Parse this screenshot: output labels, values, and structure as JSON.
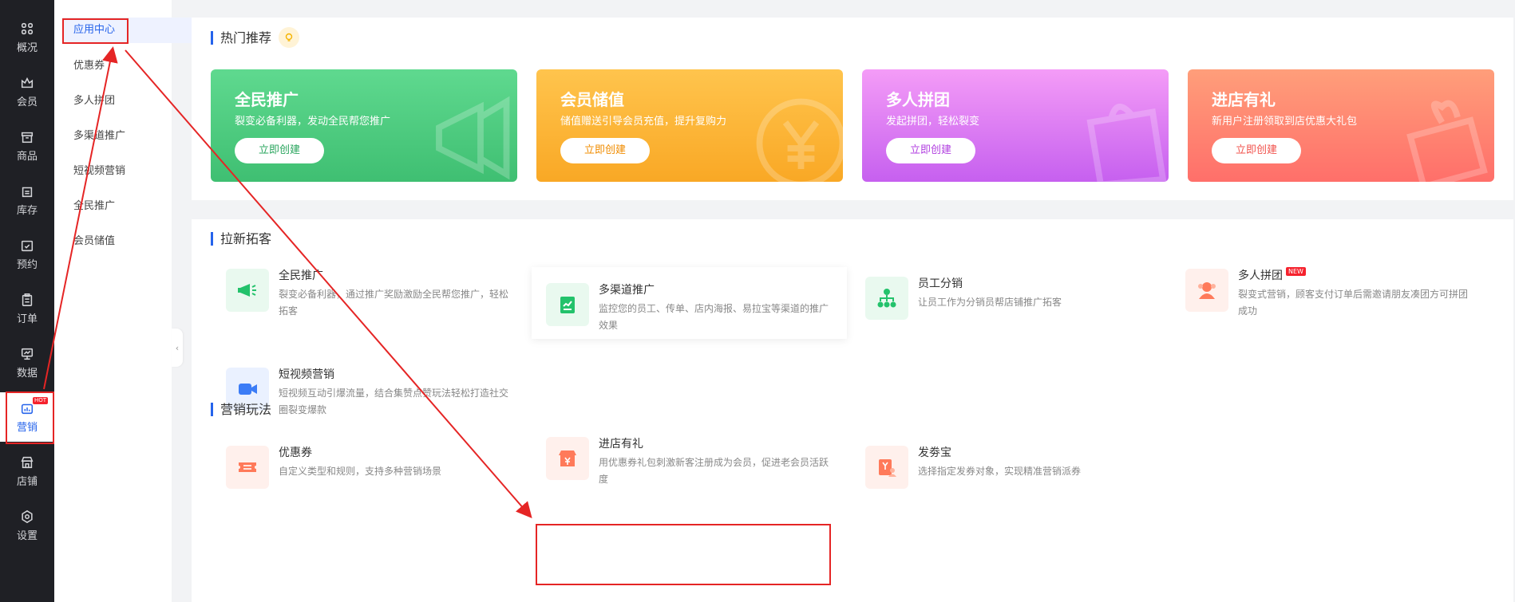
{
  "left_nav": [
    {
      "label": "概况",
      "icon": "grid-icon"
    },
    {
      "label": "会员",
      "icon": "crown-icon"
    },
    {
      "label": "商品",
      "icon": "store-box-icon"
    },
    {
      "label": "库存",
      "icon": "warehouse-icon"
    },
    {
      "label": "预约",
      "icon": "calendar-check-icon"
    },
    {
      "label": "订单",
      "icon": "clipboard-icon"
    },
    {
      "label": "数据",
      "icon": "monitor-chart-icon"
    },
    {
      "label": "营销",
      "icon": "chart-bag-icon",
      "badge": "HOT",
      "active": true
    },
    {
      "label": "店铺",
      "icon": "shop-icon"
    },
    {
      "label": "设置",
      "icon": "gear-icon"
    }
  ],
  "sub_nav": [
    {
      "label": "应用中心",
      "active": true
    },
    {
      "label": "优惠券"
    },
    {
      "label": "多人拼团"
    },
    {
      "label": "多渠道推广"
    },
    {
      "label": "短视频营销"
    },
    {
      "label": "全民推广"
    },
    {
      "label": "会员储值"
    }
  ],
  "hot_section": {
    "title": "热门推荐",
    "cards": [
      {
        "title": "全民推广",
        "desc": "裂变必备利器，发动全民帮您推广",
        "button": "立即创建",
        "color_from": "#5fd98f",
        "color_to": "#3fbf72",
        "btn_text_color": "#2aa55e",
        "icon": "megaphone-icon"
      },
      {
        "title": "会员储值",
        "desc": "储值赠送引导会员充值，提升复购力",
        "button": "立即创建",
        "color_from": "#ffc44d",
        "color_to": "#f9a825",
        "btn_text_color": "#f08c00",
        "icon": "yen-coin-icon"
      },
      {
        "title": "多人拼团",
        "desc": "发起拼团，轻松裂变",
        "button": "立即创建",
        "color_from": "#f49cf7",
        "color_to": "#c660ef",
        "btn_text_color": "#b13fe0",
        "icon": "shopping-bag-icon"
      },
      {
        "title": "进店有礼",
        "desc": "新用户注册领取到店优惠大礼包",
        "button": "立即创建",
        "color_from": "#ff9e7a",
        "color_to": "#ff6f6a",
        "btn_text_color": "#f1534d",
        "icon": "gift-icon"
      }
    ]
  },
  "acquire_section": {
    "title": "拉新拓客",
    "items": [
      {
        "name": "全民推广",
        "desc": "裂变必备利器，通过推广奖励激励全民帮您推广，轻松拓客",
        "icon": "megaphone-icon",
        "icon_bg": "#e9f9ef",
        "icon_color": "#23c26b"
      },
      {
        "name": "多渠道推广",
        "desc": "监控您的员工、传单、店内海报、易拉宝等渠道的推广效果",
        "icon": "chart-doc-icon",
        "icon_bg": "#e9f9ef",
        "icon_color": "#23c26b"
      },
      {
        "name": "员工分销",
        "desc": "让员工作为分销员帮店铺推广拓客",
        "icon": "org-tree-icon",
        "icon_bg": "#e9f9ef",
        "icon_color": "#23c26b"
      },
      {
        "name": "多人拼团",
        "badge": "NEW",
        "desc": "裂变式营销，顾客支付订单后需邀请朋友凑团方可拼团成功",
        "icon": "group-person-icon",
        "icon_bg": "#fff0ec",
        "icon_color": "#ff7a5a"
      },
      {
        "name": "短视频营销",
        "desc": "短视频互动引爆流量，结合集赞点赞玩法轻松打造社交圈裂变爆款",
        "icon": "video-camera-icon",
        "icon_bg": "#eaf1ff",
        "icon_color": "#3b7cf6"
      }
    ]
  },
  "play_section": {
    "title": "营销玩法",
    "items": [
      {
        "name": "优惠券",
        "desc": "自定义类型和规则，支持多种营销场景",
        "icon": "coupon-icon",
        "icon_bg": "#fff0ec",
        "icon_color": "#ff7a5a"
      },
      {
        "name": "进店有礼",
        "desc": "用优惠券礼包刺激新客注册成为会员，促进老会员活跃度",
        "icon": "shop-yen-icon",
        "icon_bg": "#fff0ec",
        "icon_color": "#ff7a5a"
      },
      {
        "name": "发劵宝",
        "desc": "选择指定发券对象，实现精准营销派券",
        "icon": "ticket-person-icon",
        "icon_bg": "#fff0ec",
        "icon_color": "#ff7a5a"
      }
    ]
  },
  "colors": {
    "accent": "#2563eb",
    "annotation": "#e52525",
    "sidebar": "#1f2025"
  }
}
